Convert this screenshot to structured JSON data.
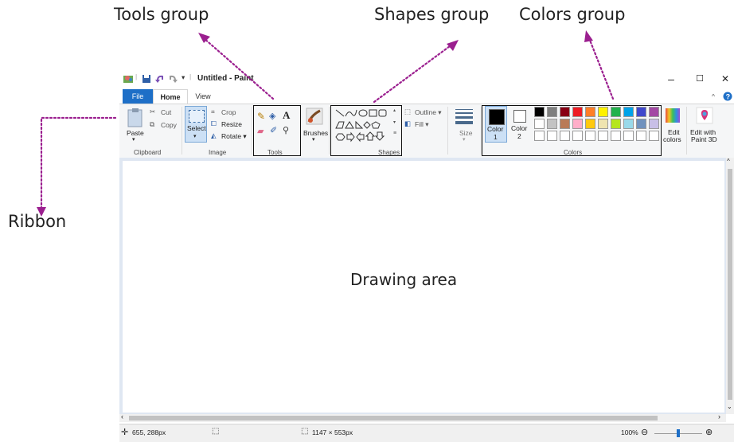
{
  "callouts": {
    "tools": "Tools group",
    "shapes": "Shapes group",
    "colors": "Colors group",
    "ribbon": "Ribbon",
    "drawing": "Drawing area"
  },
  "window": {
    "title": "Untitled - Paint",
    "controls": {
      "minimize": "–",
      "maximize": "☐",
      "close": "✕"
    }
  },
  "tabs": {
    "file": "File",
    "home": "Home",
    "view": "View"
  },
  "clipboard": {
    "paste": "Paste",
    "cut": "Cut",
    "copy": "Copy",
    "label": "Clipboard"
  },
  "image": {
    "select": "Select",
    "crop": "Crop",
    "resize": "Resize",
    "rotate": "Rotate",
    "label": "Image"
  },
  "tools": {
    "label": "Tools",
    "brushes": "Brushes"
  },
  "shapes": {
    "outline": "Outline",
    "fill": "Fill",
    "label": "Shapes",
    "size": "Size"
  },
  "colors": {
    "color1": "Color",
    "color1_num": "1",
    "color2": "Color",
    "color2_num": "2",
    "label": "Colors",
    "edit_colors_1": "Edit",
    "edit_colors_2": "colors",
    "paint3d_1": "Edit with",
    "paint3d_2": "Paint 3D",
    "palette_row1": [
      "#000000",
      "#7f7f7f",
      "#880015",
      "#ed1c24",
      "#ff7f27",
      "#fff200",
      "#22b14c",
      "#00a2e8",
      "#3f48cc",
      "#a349a4"
    ],
    "palette_row2": [
      "#ffffff",
      "#c3c3c3",
      "#b97a57",
      "#ffaec9",
      "#ffc90e",
      "#efe4b0",
      "#b5e61d",
      "#99d9ea",
      "#7092be",
      "#c8bfe7"
    ],
    "palette_row3": [
      "#ffffff",
      "#ffffff",
      "#ffffff",
      "#ffffff",
      "#ffffff",
      "#ffffff",
      "#ffffff",
      "#ffffff",
      "#ffffff",
      "#ffffff"
    ]
  },
  "status": {
    "cursor_pos": "655, 288px",
    "canvas_size": "1147 × 553px",
    "zoom": "100%"
  },
  "accent": "#1e6fc7",
  "arrow_color": "#9b1f8f"
}
